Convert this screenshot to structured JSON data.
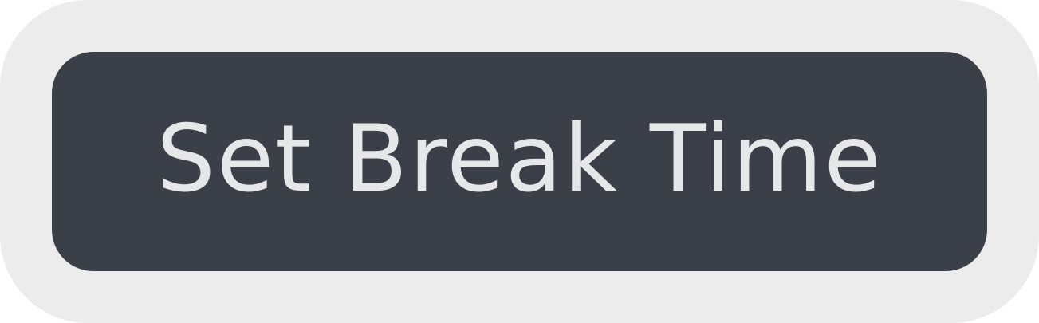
{
  "button": {
    "label": "Set Break Time"
  },
  "colors": {
    "outer_background": "#ececec",
    "button_background": "#3b3f48",
    "button_text": "#e6e7e9"
  }
}
